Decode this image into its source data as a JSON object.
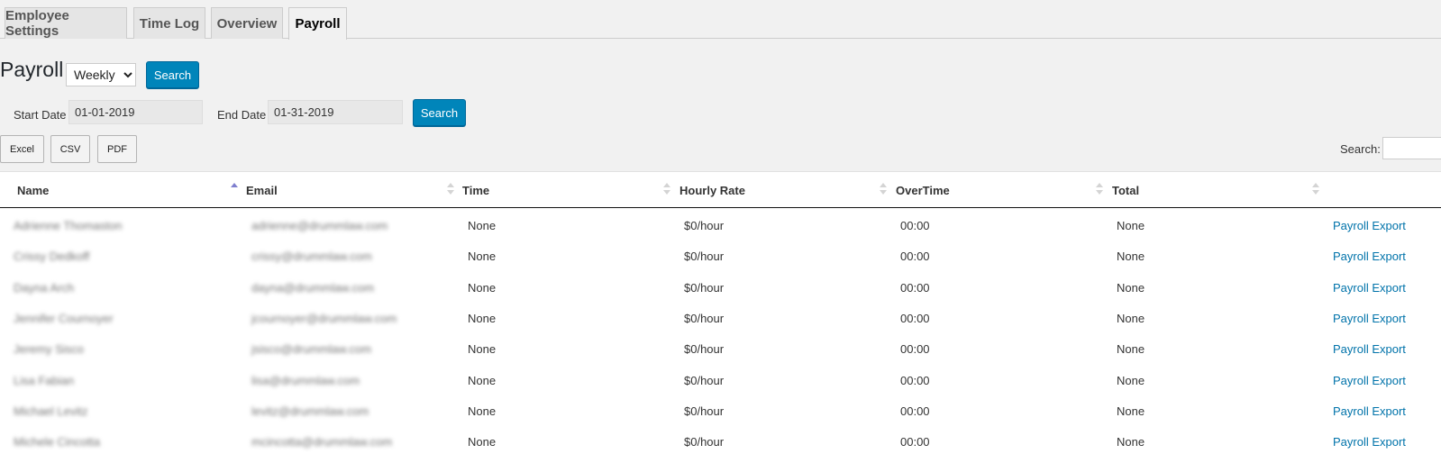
{
  "tabs": [
    {
      "label": "Employee Settings"
    },
    {
      "label": "Time Log"
    },
    {
      "label": "Overview"
    },
    {
      "label": "Payroll"
    }
  ],
  "header": {
    "title": "Payroll",
    "period_selected": "Weekly",
    "period_options": [
      "Weekly"
    ],
    "search_label": "Search"
  },
  "date_filter": {
    "start_label": "Start Date",
    "start_value": "01-01-2019",
    "end_label": "End Date",
    "end_value": "01-31-2019",
    "search_label": "Search"
  },
  "export_buttons": {
    "excel": "Excel",
    "csv": "CSV",
    "pdf": "PDF"
  },
  "table_search": {
    "label": "Search:",
    "value": ""
  },
  "table": {
    "columns": [
      "Name",
      "Email",
      "Time",
      "Hourly Rate",
      "OverTime",
      "Total"
    ],
    "rows": [
      {
        "name": "Adrienne Thomaston",
        "email": "adrienne@drummlaw.com",
        "time": "None",
        "rate": "$0/hour",
        "overtime": "00:00",
        "total": "None",
        "action": "Payroll Export"
      },
      {
        "name": "Crissy Dedkoff",
        "email": "crissy@drummlaw.com",
        "time": "None",
        "rate": "$0/hour",
        "overtime": "00:00",
        "total": "None",
        "action": "Payroll Export"
      },
      {
        "name": "Dayna Arch",
        "email": "dayna@drummlaw.com",
        "time": "None",
        "rate": "$0/hour",
        "overtime": "00:00",
        "total": "None",
        "action": "Payroll Export"
      },
      {
        "name": "Jennifer Cournoyer",
        "email": "jcournoyer@drummlaw.com",
        "time": "None",
        "rate": "$0/hour",
        "overtime": "00:00",
        "total": "None",
        "action": "Payroll Export"
      },
      {
        "name": "Jeremy Sisco",
        "email": "jsisco@drummlaw.com",
        "time": "None",
        "rate": "$0/hour",
        "overtime": "00:00",
        "total": "None",
        "action": "Payroll Export"
      },
      {
        "name": "Lisa Fabian",
        "email": "lisa@drummlaw.com",
        "time": "None",
        "rate": "$0/hour",
        "overtime": "00:00",
        "total": "None",
        "action": "Payroll Export"
      },
      {
        "name": "Michael Levitz",
        "email": "levitz@drummlaw.com",
        "time": "None",
        "rate": "$0/hour",
        "overtime": "00:00",
        "total": "None",
        "action": "Payroll Export"
      },
      {
        "name": "Michele Cincotta",
        "email": "mcincotta@drummlaw.com",
        "time": "None",
        "rate": "$0/hour",
        "overtime": "00:00",
        "total": "None",
        "action": "Payroll Export"
      }
    ]
  },
  "colors": {
    "primary_button": "#0085ba",
    "link": "#0073aa",
    "background": "#f1f1f1"
  }
}
